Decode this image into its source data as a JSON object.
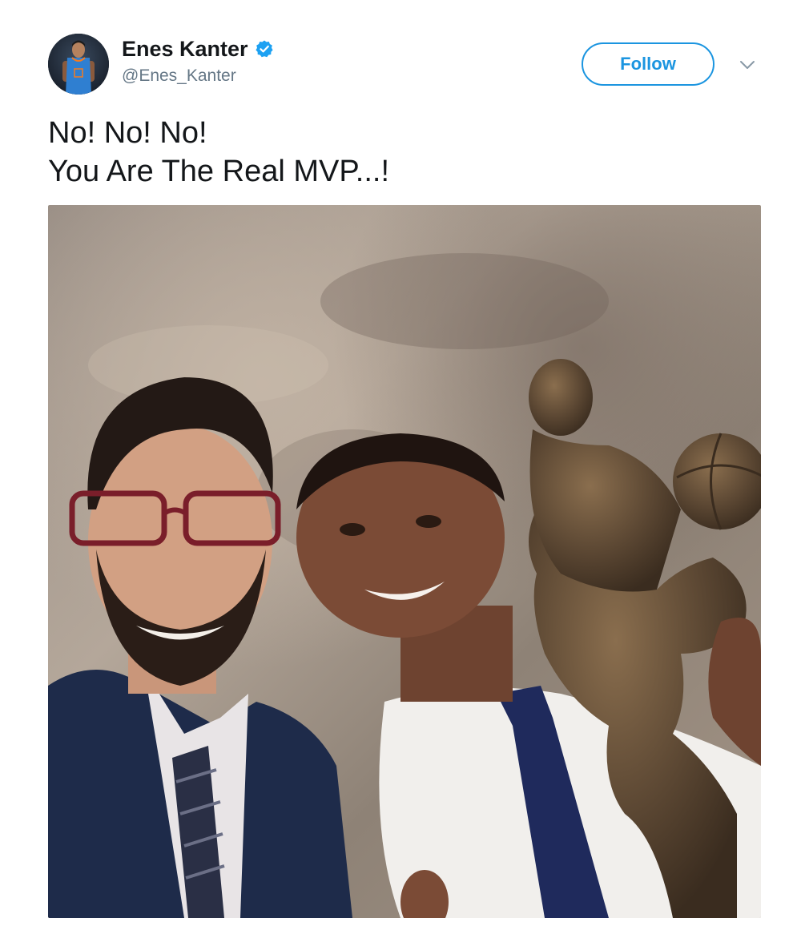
{
  "tweet": {
    "author": {
      "display_name": "Enes Kanter",
      "handle": "@Enes_Kanter",
      "verified": true,
      "avatar_icon": "user-avatar-icon"
    },
    "actions": {
      "follow_label": "Follow",
      "menu_icon": "chevron-down-icon"
    },
    "text_lines": [
      "No! No! No!",
      "You Are The Real MVP...!"
    ],
    "media": {
      "type": "photo"
    }
  },
  "colors": {
    "accent": "#1b95e0",
    "verified": "#1da1f2",
    "text_primary": "#14171a",
    "text_secondary": "#657786"
  }
}
